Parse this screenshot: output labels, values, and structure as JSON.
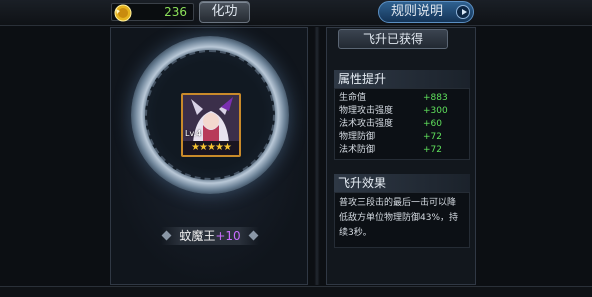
{
  "currency": {
    "icon": "gold-coin-icon",
    "amount": "236"
  },
  "toolbar": {
    "refine_label": "化功",
    "rules_label": "规则说明"
  },
  "hero": {
    "name": "蚊魔王",
    "plus": "+10",
    "level": "Lv.4",
    "stars": 5,
    "star_glyphs": "★★★★★"
  },
  "ascend": {
    "status": "飞升已获得"
  },
  "attributes": {
    "title": "属性提升",
    "rows": [
      {
        "name": "生命值",
        "value": "+883"
      },
      {
        "name": "物理攻击强度",
        "value": "+300"
      },
      {
        "name": "法术攻击强度",
        "value": "+60"
      },
      {
        "name": "物理防御",
        "value": "+72"
      },
      {
        "name": "法术防御",
        "value": "+72"
      }
    ]
  },
  "effect": {
    "title": "飞升效果",
    "lines": [
      "普攻三段击的最后一击可以降",
      "低敌方单位物理防御43%，持",
      "续3秒。"
    ]
  },
  "colors": {
    "stat_value": "#5fe05c",
    "hero_plus": "#c86dff",
    "star": "#f6c230",
    "coin_amount": "#8ce05a"
  }
}
